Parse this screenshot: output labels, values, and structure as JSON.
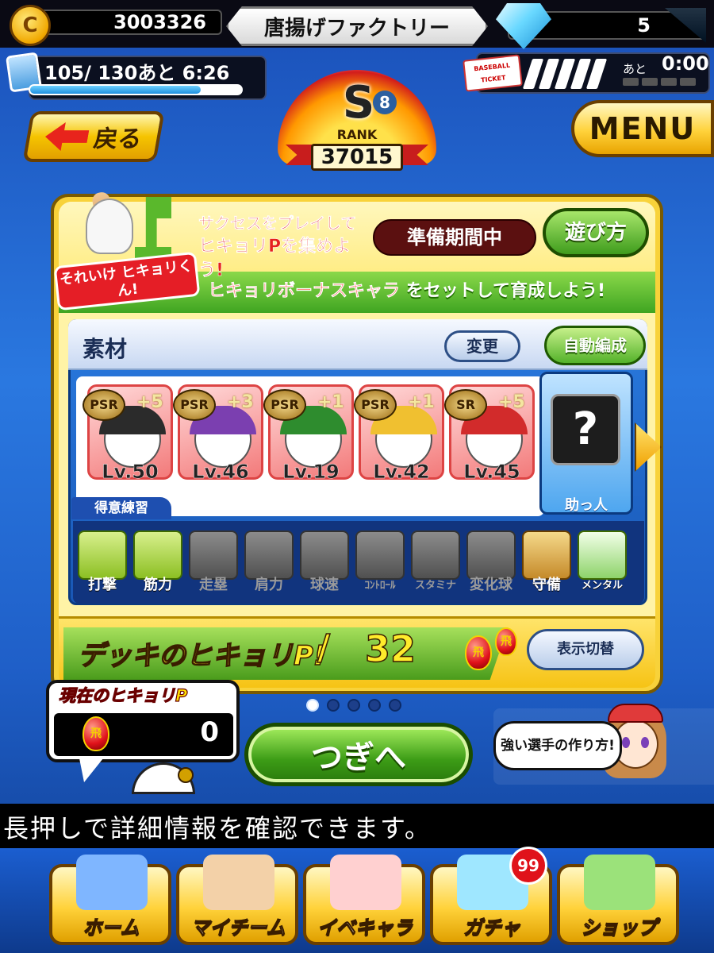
{
  "header": {
    "coins": "3003326",
    "title": "唐揚げファクトリー",
    "gems": "5"
  },
  "stamina": {
    "text": "105/ 130あと  6:26",
    "fill_fraction": 0.81
  },
  "tickets": {
    "badge_line1": "BASEBALL",
    "badge_line2": "TICKET",
    "after_label": "あと",
    "time": "0:00",
    "filled_slots": 5
  },
  "back_button": {
    "label": "戻る"
  },
  "rank": {
    "letter": "S",
    "sub": "8",
    "label": "RANK",
    "score": "37015"
  },
  "menu_button": {
    "label": "MENU"
  },
  "banner": {
    "logo_text": "それいけ ヒキョリくん!",
    "cta_line1": "サクセスをプレイして",
    "cta_line2": "ヒキョリPを集めよう!",
    "status": "準備期間中",
    "howto_label": "遊び方",
    "bonus_emphasis": "ヒキョリボーナスキャラ",
    "bonus_rest": "をセットして育成しよう!"
  },
  "deck": {
    "title": "素材",
    "change_label": "変更",
    "auto_label": "自動編成",
    "cards": [
      {
        "rarity": "PSR",
        "bonus": "+5",
        "level": "Lv.50",
        "cap_color": "#2b2b2b"
      },
      {
        "rarity": "PSR",
        "bonus": "+3",
        "level": "Lv.46",
        "cap_color": "#7b3fb0"
      },
      {
        "rarity": "PSR",
        "bonus": "+1",
        "level": "Lv.19",
        "cap_color": "#2e8c2e"
      },
      {
        "rarity": "PSR",
        "bonus": "+1",
        "level": "Lv.42",
        "cap_color": "#f0c030"
      },
      {
        "rarity": "SR",
        "bonus": "+5",
        "level": "Lv.45",
        "cap_color": "#d22b2b"
      }
    ],
    "helper_symbol": "?",
    "helper_label": "助っ人",
    "practice_tab": "得意練習",
    "practices": [
      {
        "label": "打撃",
        "active": true,
        "icon": "bat-icon"
      },
      {
        "label": "筋力",
        "active": true,
        "icon": "dumbbell-icon"
      },
      {
        "label": "走塁",
        "active": false,
        "icon": "base-icon"
      },
      {
        "label": "肩力",
        "active": false,
        "icon": "shoulder-icon"
      },
      {
        "label": "球速",
        "active": false,
        "icon": "speed-ball-icon"
      },
      {
        "label": "ｺﾝﾄﾛｰﾙ",
        "active": false,
        "icon": "target-icon"
      },
      {
        "label": "スタミナ",
        "active": false,
        "icon": "tire-icon"
      },
      {
        "label": "変化球",
        "active": false,
        "icon": "breaking-ball-icon"
      },
      {
        "label": "守備",
        "active": true,
        "icon": "glove-icon"
      },
      {
        "label": "メンタル",
        "active": true,
        "icon": "mental-icon"
      }
    ]
  },
  "deck_points": {
    "label": "デッキのヒキョリP!",
    "slash": "/",
    "value": "32",
    "egg1": "飛",
    "egg2": "飛",
    "toggle_label": "表示切替"
  },
  "pagination": {
    "total": 5,
    "active": 0
  },
  "current_points": {
    "label": "現在のヒキョリP",
    "egg": "飛",
    "value": "0"
  },
  "next_button": {
    "label": "つぎへ"
  },
  "guide": {
    "text": "強い選手の作り方!"
  },
  "ticker": {
    "text": "長押しで詳細情報を確認できます。"
  },
  "nav": [
    {
      "label": "ホーム",
      "icon": "book-icon"
    },
    {
      "label": "マイチーム",
      "icon": "team-icon"
    },
    {
      "label": "イベキャラ",
      "icon": "event-chara-icon"
    },
    {
      "label": "ガチャ",
      "icon": "gacha-icon",
      "badge": "99"
    },
    {
      "label": "ショップ",
      "icon": "shop-icon"
    }
  ],
  "colors": {
    "panel_yellow": "#f8d23a",
    "green_button": "#3c9c16",
    "red_accent": "#e0121a",
    "deck_blue": "#1957b5"
  }
}
